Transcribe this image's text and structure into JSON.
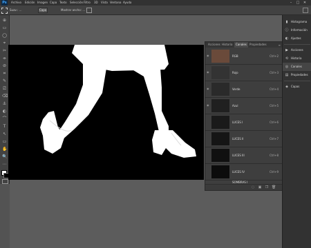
{
  "app": {
    "logo": "Ps"
  },
  "menu": [
    "Archivo",
    "Edición",
    "Imagen",
    "Capa",
    "Texto",
    "Selección",
    "Filtro",
    "3D",
    "Vista",
    "Ventana",
    "Ayuda"
  ],
  "window_controls": [
    "–",
    "□",
    "✕"
  ],
  "options_bar": {
    "tool_icon": "marquee-tool-icon",
    "dropdown_text": "Suav.: …",
    "selection_label": "Seleccionar y aplicar máscara...",
    "style_value": "Capa",
    "extra_label": "Mostrar ancho: ..."
  },
  "tools": [
    "⊕",
    "▭",
    "◯",
    "⌖",
    "✂",
    "⌯",
    "⊘",
    "⌗",
    "✎",
    "⎚",
    "⌫",
    "⚓",
    "◐",
    "⌒",
    "T",
    "↖",
    "▭",
    "✋",
    "🔍",
    "⋯"
  ],
  "channels_panel": {
    "tabs": [
      "Acciones",
      "Historia",
      "Canales",
      "Propiedades"
    ],
    "active_tab": "Canales",
    "channels": [
      {
        "name": "RGB",
        "shortcut": "Ctrl+2"
      },
      {
        "name": "Rojo",
        "shortcut": "Ctrl+3"
      },
      {
        "name": "Verde",
        "shortcut": "Ctrl+4"
      },
      {
        "name": "Azul",
        "shortcut": "Ctrl+5"
      },
      {
        "name": "LUCES I",
        "shortcut": "Ctrl+6"
      },
      {
        "name": "LUCES II",
        "shortcut": "Ctrl+7"
      },
      {
        "name": "LUCES III",
        "shortcut": "Ctrl+8"
      },
      {
        "name": "LUCES IV",
        "shortcut": "Ctrl+9"
      },
      {
        "name": "SOMBRAS I",
        "shortcut": ""
      }
    ]
  },
  "right_panel": {
    "group1": [
      {
        "icon": "histogram-icon",
        "label": "Histograma"
      },
      {
        "icon": "info-icon",
        "label": "Información"
      },
      {
        "icon": "adjustments-icon",
        "label": "Ajustes"
      }
    ],
    "group2": [
      {
        "icon": "play-icon",
        "label": "Acciones"
      },
      {
        "icon": "history-icon",
        "label": "Historia"
      },
      {
        "icon": "channels-icon",
        "label": "Canales"
      },
      {
        "icon": "properties-icon",
        "label": "Propiedades"
      }
    ],
    "group3": [
      {
        "icon": "layers-icon",
        "label": "Capas"
      }
    ]
  },
  "colors": {
    "accent": "#3fa6ff",
    "panel": "#3e3e3e",
    "workspace": "#5c5c5c"
  }
}
